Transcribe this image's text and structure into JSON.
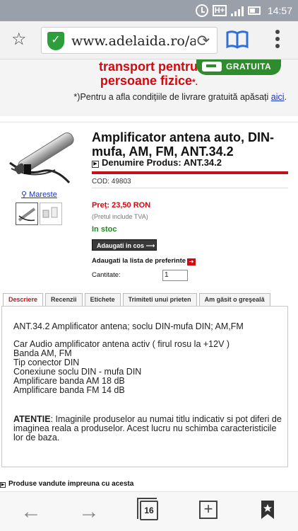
{
  "status_bar": {
    "time": "14:57",
    "network": "H+"
  },
  "browser": {
    "url": "www.adelaida.ro/an"
  },
  "promo": {
    "title": "transport pentru persoane fizice",
    "title_suffix": "*.",
    "badge": "GRATUITA",
    "note_prefix": "*)Pentru a afla condițiile de livrare gratuită apăsați ",
    "note_link": "aici",
    "note_suffix": "."
  },
  "product": {
    "mareste": "Mareste",
    "title": "Amplificator antena auto, DIN-mufa, AM, FM, ANT.34.2",
    "denumire": "Denumire Produs: ANT.34.2",
    "cod": "COD: 49803",
    "price": "Preț: 23,50 RON",
    "tva": "(Pretul include TVA)",
    "stock": "In stoc",
    "add_to_cart": "Adaugati in cos",
    "favorites": "Adaugati la lista de preferinte",
    "quantity_label": "Cantitate:",
    "quantity_value": "1"
  },
  "tabs": [
    {
      "label": "Descriere",
      "active": true
    },
    {
      "label": "Recenzii",
      "active": false
    },
    {
      "label": "Etichete",
      "active": false
    },
    {
      "label": "Trimiteti unui prieten",
      "active": false
    },
    {
      "label": "Am găsit o greşeală",
      "active": false
    }
  ],
  "description": {
    "line1": "ANT.34.2 Amplificator antena; soclu DIN-mufa DIN; AM,FM",
    "details": [
      "Car Audio amplificator antena activ ( firul rosu la +12V )",
      "Banda AM, FM",
      "Tip conector DIN",
      "Conexiune soclu DIN - mufa DIN",
      "Amplificare banda AM 18 dB",
      "Amplificare banda FM 14 dB"
    ],
    "warning_label": "ATENTIE",
    "warning_text": ": Imaginile produselor au numai titlu indicativ si pot diferi de imaginea reala a produselor. Acest lucru nu schimba caracteristicile lor de baza."
  },
  "related": "Produse vandute impreuna cu acesta",
  "bottom_nav": {
    "tab_count": "16"
  },
  "colors": {
    "brand_red": "#d10a11",
    "stock_green": "#1f8a1f",
    "link_blue": "#1a35c0"
  }
}
